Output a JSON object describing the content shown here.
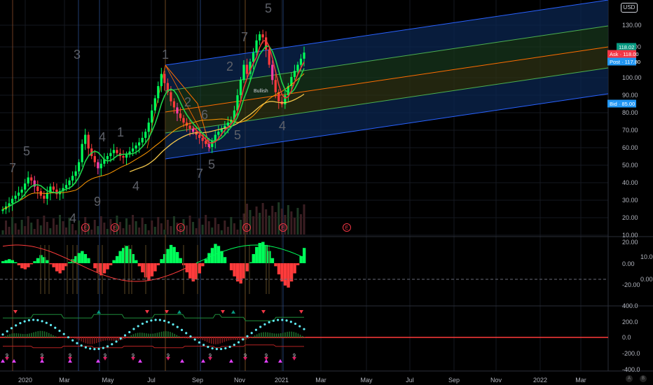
{
  "currency": "USD",
  "buttons": {
    "auto": "A",
    "log": "B"
  },
  "colors": {
    "up": "#00ff5a",
    "down": "#ff3b3b",
    "pink": "#ff3da5",
    "fork_blue": "#2962ff",
    "fork_green": "#4caf50",
    "fork_red": "#ff6d00",
    "ma_yellow": "#f5c84b",
    "ma_green": "#1fd44a",
    "ma_red": "#e53935",
    "tag_green": "#089981",
    "tag_red": "#f23645",
    "tag_blue": "#2196f3"
  },
  "chart_data": [
    {
      "type": "candlestick",
      "y_ticks": [
        "130.00",
        "110.00",
        "100.00",
        "90.00",
        "80.00",
        "70.00",
        "60.00",
        "50.00",
        "40.00",
        "30.00",
        "20.00",
        "10.00"
      ],
      "x_ticks": [
        "2020",
        "Mar",
        "May",
        "Jul",
        "Sep",
        "Nov",
        "2021",
        "Mar",
        "May",
        "Jul",
        "Sep",
        "Nov",
        "2022",
        "Mar"
      ],
      "price_tags": [
        {
          "label": "",
          "value": "118.02",
          "kind": "last"
        },
        {
          "label": "Ask",
          "value": "118.00",
          "kind": "ask"
        },
        {
          "label": "Post",
          "value": "117.80",
          "kind": "post"
        },
        {
          "label": "Bid",
          "value": "85.00",
          "kind": "bid"
        }
      ],
      "wave_labels": [
        "7",
        "5",
        "3",
        "4",
        "1",
        "4",
        "9",
        "4",
        "1",
        "2",
        "6",
        "7",
        "5",
        "2",
        "7",
        "5",
        "5",
        "4"
      ],
      "annotations": [
        "Bullish"
      ],
      "events": [
        "E",
        "E",
        "E",
        "E",
        "E",
        "E"
      ],
      "closes": [
        15,
        17,
        19,
        22,
        24,
        26,
        28,
        32,
        36,
        34,
        30,
        27,
        24,
        22,
        26,
        30,
        28,
        25,
        27,
        29,
        31,
        34,
        37,
        40,
        46,
        58,
        64,
        55,
        50,
        46,
        42,
        45,
        48,
        50,
        52,
        54,
        52,
        50,
        49,
        51,
        53,
        55,
        57,
        59,
        62,
        66,
        72,
        80,
        88,
        96,
        104,
        98,
        92,
        86,
        82,
        78,
        75,
        72,
        70,
        68,
        66,
        64,
        62,
        60,
        58,
        56,
        60,
        64,
        66,
        68,
        70,
        72,
        74,
        80,
        90,
        100,
        110,
        104,
        112,
        118,
        126,
        130,
        128,
        120,
        110,
        100,
        92,
        86,
        84,
        90,
        96,
        102,
        106,
        110,
        114,
        118
      ],
      "ma_green": "short-term moving average",
      "ma_red": "medium-term moving average",
      "ma_yellow": "long-term moving average"
    },
    {
      "type": "histogram",
      "y_ticks": [
        "20.00",
        "10.00",
        "0.00",
        "0.00",
        "-20.00"
      ],
      "values": [
        2,
        3,
        4,
        3,
        1,
        -2,
        -5,
        -6,
        -4,
        -1,
        2,
        5,
        8,
        6,
        3,
        -1,
        -4,
        -8,
        -10,
        -7,
        -3,
        1,
        4,
        7,
        10,
        12,
        9,
        5,
        0,
        -5,
        -9,
        -12,
        -10,
        -6,
        -2,
        3,
        7,
        12,
        15,
        17,
        14,
        9,
        3,
        -3,
        -9,
        -14,
        -17,
        -13,
        -8,
        -2,
        4,
        9,
        14,
        18,
        16,
        11,
        5,
        -2,
        -9,
        -15,
        -18,
        -16,
        -10,
        -3,
        4,
        10,
        15,
        19,
        17,
        12,
        6,
        0,
        -7,
        -13,
        -18,
        -20,
        -15,
        -8,
        1,
        9,
        16,
        20,
        21,
        18,
        12,
        5,
        -3,
        -11,
        -18,
        -22,
        -24,
        -18,
        -10,
        -2,
        7,
        15
      ]
    },
    {
      "type": "oscillator",
      "y_ticks": [
        "400.0",
        "200.0",
        "0.0",
        "-200.0",
        "-400.0"
      ]
    }
  ]
}
